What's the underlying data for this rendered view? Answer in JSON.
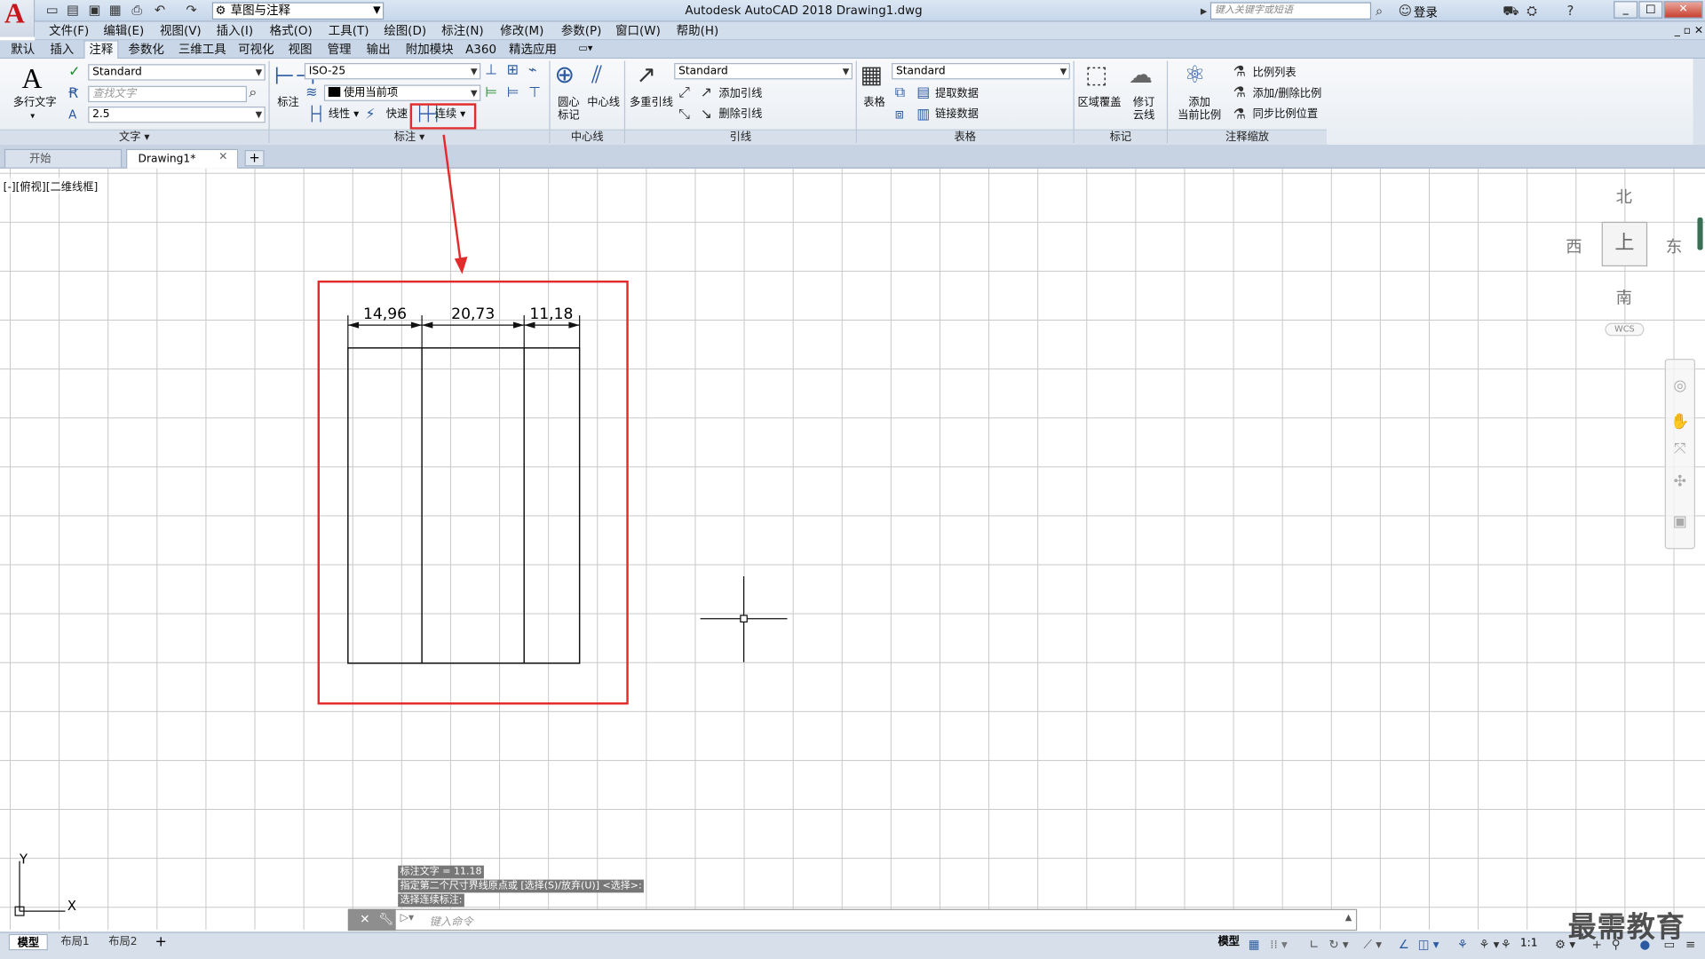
{
  "titlebar": {
    "workspace": "草图与注释",
    "app_title": "Autodesk AutoCAD 2018    Drawing1.dwg",
    "search_placeholder": "键入关键字或短语",
    "login": "登录"
  },
  "menu": [
    "文件(F)",
    "编辑(E)",
    "视图(V)",
    "插入(I)",
    "格式(O)",
    "工具(T)",
    "绘图(D)",
    "标注(N)",
    "修改(M)",
    "参数(P)",
    "窗口(W)",
    "帮助(H)"
  ],
  "ribbon_tabs": [
    "默认",
    "插入",
    "注释",
    "参数化",
    "三维工具",
    "可视化",
    "视图",
    "管理",
    "输出",
    "附加模块",
    "A360",
    "精选应用"
  ],
  "active_tab": "注释",
  "ribbon": {
    "text_panel": {
      "title": "文字",
      "mtext": "多行文字",
      "text_style": "Standard",
      "find_placeholder": "查找文字",
      "text_height": "2.5"
    },
    "dim_panel": {
      "title": "标注",
      "dim_label": "标注",
      "dim_style": "ISO-25",
      "layer": "使用当前项",
      "linear": "线性",
      "quick": "快速",
      "continue": "连续"
    },
    "centerline_panel": {
      "title": "中心线",
      "center_mark": "圆心\n标记",
      "centerline": "中心线"
    },
    "leader_panel": {
      "title": "引线",
      "multileader": "多重引线",
      "style": "Standard",
      "add": "添加引线",
      "remove": "删除引线"
    },
    "table_panel": {
      "title": "表格",
      "table": "表格",
      "style": "Standard",
      "extract": "提取数据",
      "link": "链接数据"
    },
    "markup_panel": {
      "title": "标记",
      "wipeout": "区域覆盖",
      "revcloud": "修订\n云线"
    },
    "scale_panel": {
      "title": "注释缩放",
      "add_current": "添加\n当前比例",
      "scale_list": "比例列表",
      "add_delete": "添加/删除比例",
      "sync": "同步比例位置"
    }
  },
  "file_tabs": [
    "开始",
    "Drawing1*"
  ],
  "viewport_label": "[-][俯视][二维线框]",
  "viewcube": {
    "north": "北",
    "south": "南",
    "east": "东",
    "west": "西",
    "top": "上",
    "wcs": "WCS"
  },
  "drawing": {
    "dims": [
      "14,96",
      "20,73",
      "11,18"
    ]
  },
  "command": {
    "history": [
      "标注文字 = 11.18",
      "指定第二个尺寸界线原点或 [选择(S)/放弃(U)] <选择>:",
      "选择连续标注:"
    ],
    "placeholder": "键入命令"
  },
  "layout_tabs": [
    "模型",
    "布局1",
    "布局2"
  ],
  "status": {
    "model": "模型",
    "scale": "1:1"
  },
  "watermark": "最需教育",
  "colors": {
    "highlight": "#e32b2b",
    "ribbon_bg": "#eef2f7",
    "canvas_grid": "#c8c8c8"
  }
}
